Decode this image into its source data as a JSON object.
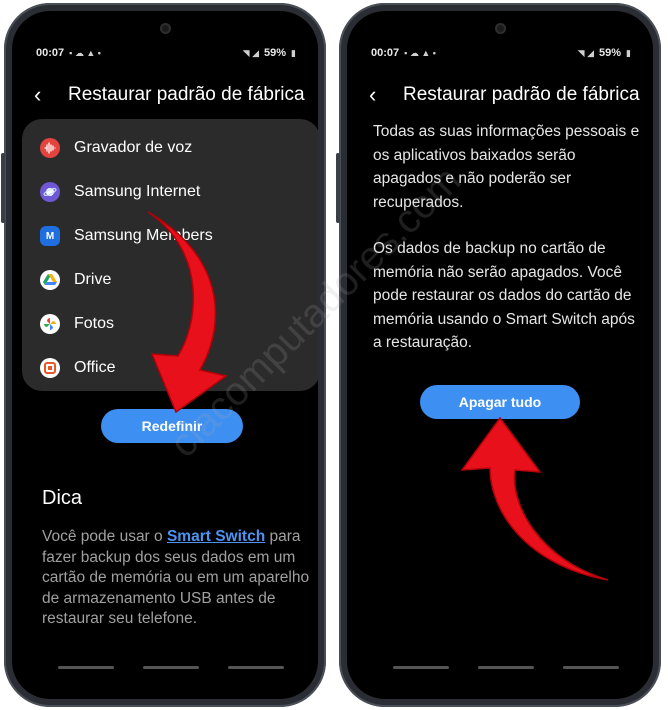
{
  "left_screen": {
    "status": {
      "time": "00:07",
      "battery": "59%"
    },
    "header": {
      "back_glyph": "‹",
      "title": "Restaurar padrão de fábrica"
    },
    "apps": [
      {
        "label": "Gravador de voz",
        "icon": "voice-recorder-icon",
        "color": "#e5433d"
      },
      {
        "label": "Samsung Internet",
        "icon": "samsung-internet-icon",
        "color": "#6f57d6"
      },
      {
        "label": "Samsung Members",
        "icon": "samsung-members-icon",
        "color": "#1f6fe0"
      },
      {
        "label": "Drive",
        "icon": "google-drive-icon",
        "color": "#f2b318"
      },
      {
        "label": "Fotos",
        "icon": "google-photos-icon",
        "color": "#e94335"
      },
      {
        "label": "Office",
        "icon": "office-icon",
        "color": "#e5582a"
      }
    ],
    "reset_button": "Redefinir",
    "tip": {
      "title": "Dica",
      "text_before": "Você pode usar o ",
      "link": "Smart Switch",
      "text_after": " para fazer backup dos seus dados em um cartão de memória ou em um aparelho de armazenamento USB antes de restaurar seu telefone."
    }
  },
  "right_screen": {
    "status": {
      "time": "00:07",
      "battery": "59%"
    },
    "header": {
      "back_glyph": "‹",
      "title": "Restaurar padrão de fábrica"
    },
    "paragraph1": "Todas as suas informações pessoais e os aplicativos baixados serão apagados e não poderão ser recuperados.",
    "paragraph2": "Os dados de backup no cartão de memória não serão apagados. Você pode restaurar os dados do cartão de memória usando o Smart Switch após a restauração.",
    "erase_button": "Apagar tudo"
  },
  "watermark": "ciacomputadores.com",
  "colors": {
    "accent": "#3e8ff2",
    "arrow": "#e8101a",
    "background": "#000000"
  }
}
